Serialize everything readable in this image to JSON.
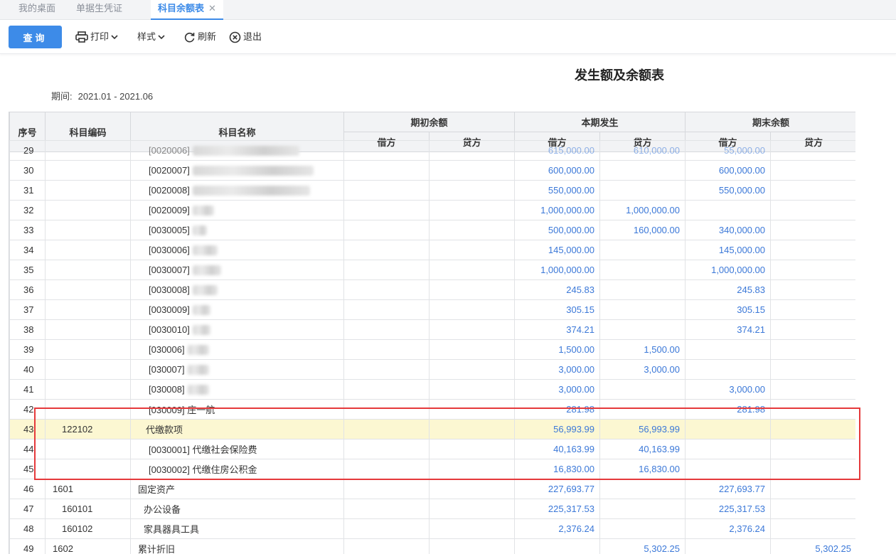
{
  "tabs": [
    {
      "label": "我的桌面"
    },
    {
      "label": "单据生凭证"
    },
    {
      "label": "科目余额表",
      "close": "✕"
    }
  ],
  "toolbar": {
    "query_label": "查询",
    "print_label": "打印",
    "style_label": "样式",
    "refresh_label": "刷新",
    "exit_label": "退出"
  },
  "report": {
    "title": "发生额及余额表",
    "period_label": "期间:",
    "period_value": "2021.01 - 2021.06"
  },
  "table": {
    "headers": {
      "idx": "序号",
      "code": "科目编码",
      "name": "科目名称",
      "opening": "期初余额",
      "current": "本期发生",
      "closing": "期末余额",
      "debit": "借方",
      "credit": "贷方"
    },
    "rows": [
      {
        "idx": "29",
        "code": "",
        "name": "[0020006]",
        "blur": true,
        "od": "",
        "oc": "",
        "cd": "615,000.00",
        "cc": "610,000.00",
        "ed": "55,000.00",
        "ec": "",
        "faded": true
      },
      {
        "idx": "30",
        "code": "",
        "name": "[0020007]",
        "blur": true,
        "od": "",
        "oc": "",
        "cd": "600,000.00",
        "cc": "",
        "ed": "600,000.00",
        "ec": ""
      },
      {
        "idx": "31",
        "code": "",
        "name": "[0020008]",
        "blur": true,
        "od": "",
        "oc": "",
        "cd": "550,000.00",
        "cc": "",
        "ed": "550,000.00",
        "ec": ""
      },
      {
        "idx": "32",
        "code": "",
        "name": "[0020009]",
        "blur": true,
        "od": "",
        "oc": "",
        "cd": "1,000,000.00",
        "cc": "1,000,000.00",
        "ed": "",
        "ec": ""
      },
      {
        "idx": "33",
        "code": "",
        "name": "[0030005]",
        "blur": true,
        "od": "",
        "oc": "",
        "cd": "500,000.00",
        "cc": "160,000.00",
        "ed": "340,000.00",
        "ec": ""
      },
      {
        "idx": "34",
        "code": "",
        "name": "[0030006]",
        "blur": true,
        "od": "",
        "oc": "",
        "cd": "145,000.00",
        "cc": "",
        "ed": "145,000.00",
        "ec": ""
      },
      {
        "idx": "35",
        "code": "",
        "name": "[0030007]",
        "blur": true,
        "od": "",
        "oc": "",
        "cd": "1,000,000.00",
        "cc": "",
        "ed": "1,000,000.00",
        "ec": ""
      },
      {
        "idx": "36",
        "code": "",
        "name": "[0030008]",
        "blur": true,
        "od": "",
        "oc": "",
        "cd": "245.83",
        "cc": "",
        "ed": "245.83",
        "ec": ""
      },
      {
        "idx": "37",
        "code": "",
        "name": "[0030009]",
        "blur": true,
        "od": "",
        "oc": "",
        "cd": "305.15",
        "cc": "",
        "ed": "305.15",
        "ec": ""
      },
      {
        "idx": "38",
        "code": "",
        "name": "[0030010]",
        "blur": true,
        "od": "",
        "oc": "",
        "cd": "374.21",
        "cc": "",
        "ed": "374.21",
        "ec": ""
      },
      {
        "idx": "39",
        "code": "",
        "name": "[030006]",
        "blur": true,
        "od": "",
        "oc": "",
        "cd": "1,500.00",
        "cc": "1,500.00",
        "ed": "",
        "ec": ""
      },
      {
        "idx": "40",
        "code": "",
        "name": "[030007]",
        "blur": true,
        "od": "",
        "oc": "",
        "cd": "3,000.00",
        "cc": "3,000.00",
        "ed": "",
        "ec": ""
      },
      {
        "idx": "41",
        "code": "",
        "name": "[030008]",
        "blur": true,
        "od": "",
        "oc": "",
        "cd": "3,000.00",
        "cc": "",
        "ed": "3,000.00",
        "ec": ""
      },
      {
        "idx": "42",
        "code": "",
        "name": "[030009] 庄一航",
        "blur": false,
        "od": "",
        "oc": "",
        "cd": "281.98",
        "cc": "",
        "ed": "281.98",
        "ec": ""
      },
      {
        "idx": "43",
        "code": "122102",
        "name": "代缴款项",
        "blur": false,
        "od": "",
        "oc": "",
        "cd": "56,993.99",
        "cc": "56,993.99",
        "ed": "",
        "ec": "",
        "highlight": true,
        "level": 1
      },
      {
        "idx": "44",
        "code": "",
        "name": "[0030001] 代缴社会保险费",
        "blur": false,
        "od": "",
        "oc": "",
        "cd": "40,163.99",
        "cc": "40,163.99",
        "ed": "",
        "ec": ""
      },
      {
        "idx": "45",
        "code": "",
        "name": "[0030002] 代缴住房公积金",
        "blur": false,
        "od": "",
        "oc": "",
        "cd": "16,830.00",
        "cc": "16,830.00",
        "ed": "",
        "ec": ""
      },
      {
        "idx": "46",
        "code": "1601",
        "name": "固定资产",
        "blur": false,
        "od": "",
        "oc": "",
        "cd": "227,693.77",
        "cc": "",
        "ed": "227,693.77",
        "ec": "",
        "level": 0
      },
      {
        "idx": "47",
        "code": "160101",
        "name": "办公设备",
        "blur": false,
        "od": "",
        "oc": "",
        "cd": "225,317.53",
        "cc": "",
        "ed": "225,317.53",
        "ec": "",
        "level": 1
      },
      {
        "idx": "48",
        "code": "160102",
        "name": "家具器具工具",
        "blur": false,
        "od": "",
        "oc": "",
        "cd": "2,376.24",
        "cc": "",
        "ed": "2,376.24",
        "ec": "",
        "level": 1
      },
      {
        "idx": "49",
        "code": "1602",
        "name": "累计折旧",
        "blur": false,
        "od": "",
        "oc": "",
        "cd": "",
        "cc": "5,302.25",
        "ed": "",
        "ec": "5,302.25",
        "level": 0
      }
    ]
  }
}
